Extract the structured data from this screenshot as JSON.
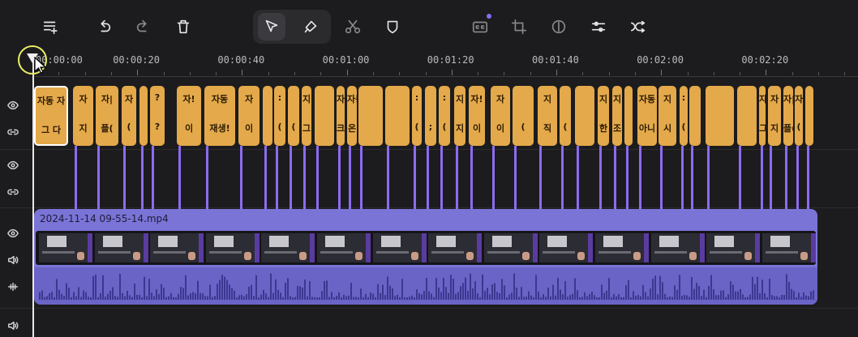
{
  "toolbar": {
    "buttons": [
      {
        "name": "add-track-icon"
      },
      {
        "name": "undo-icon"
      },
      {
        "name": "redo-icon"
      },
      {
        "name": "delete-icon"
      },
      {
        "name": "select-tool-icon"
      },
      {
        "name": "blade-tool-icon"
      },
      {
        "name": "split-icon"
      },
      {
        "name": "mask-icon"
      },
      {
        "name": "captions-icon"
      },
      {
        "name": "crop-icon"
      },
      {
        "name": "color-icon"
      },
      {
        "name": "adjust-icon"
      },
      {
        "name": "transition-icon"
      }
    ]
  },
  "ruler": {
    "labels": [
      "00:00:00",
      "00:00:20",
      "00:00:40",
      "00:01:00",
      "00:01:20",
      "00:01:40",
      "00:02:00",
      "00:02:20"
    ]
  },
  "captions": [
    {
      "t1": "자동 자",
      "t2": "그 다"
    },
    {
      "t1": "자",
      "t2": "지"
    },
    {
      "t1": "자|",
      "t2": "플("
    },
    {
      "t1": "자",
      "t2": "("
    },
    {
      "t1": "",
      "t2": ""
    },
    {
      "t1": "?",
      "t2": "?"
    },
    {
      "t1": "자!",
      "t2": "이"
    },
    {
      "t1": "자동",
      "t2": "재생!"
    },
    {
      "t1": "자",
      "t2": "이"
    },
    {
      "t1": "",
      "t2": ""
    },
    {
      "t1": ":",
      "t2": "("
    },
    {
      "t1": "",
      "t2": "("
    },
    {
      "t1": "지",
      "t2": "그"
    },
    {
      "t1": "",
      "t2": ""
    },
    {
      "t1": "자동",
      "t2": "크기"
    },
    {
      "t1": "자동",
      "t2": "온"
    },
    {
      "t1": "",
      "t2": ""
    },
    {
      "t1": "",
      "t2": ""
    },
    {
      "t1": ":",
      "t2": "("
    },
    {
      "t1": "",
      "t2": ";"
    },
    {
      "t1": ":",
      "t2": "("
    },
    {
      "t1": "지",
      "t2": "지"
    },
    {
      "t1": "자!",
      "t2": "이"
    },
    {
      "t1": "자",
      "t2": "이"
    },
    {
      "t1": "",
      "t2": "("
    },
    {
      "t1": "지",
      "t2": "직"
    },
    {
      "t1": "",
      "t2": "("
    },
    {
      "t1": "",
      "t2": ""
    },
    {
      "t1": "지",
      "t2": "한"
    },
    {
      "t1": "지",
      "t2": "조"
    },
    {
      "t1": "",
      "t2": ""
    },
    {
      "t1": "자동",
      "t2": "아니"
    },
    {
      "t1": "지",
      "t2": "시"
    },
    {
      "t1": ":",
      "t2": "("
    },
    {
      "t1": "",
      "t2": ""
    },
    {
      "t1": "",
      "t2": ""
    },
    {
      "t1": "",
      "t2": ""
    }
  ],
  "clip": {
    "title": "2024-11-14 09-55-14.mp4",
    "color": "#7a74d6"
  },
  "colors": {
    "caption": "#e4a94a",
    "connector": "#8c6cf0",
    "playhead": "#e8e8e8"
  }
}
